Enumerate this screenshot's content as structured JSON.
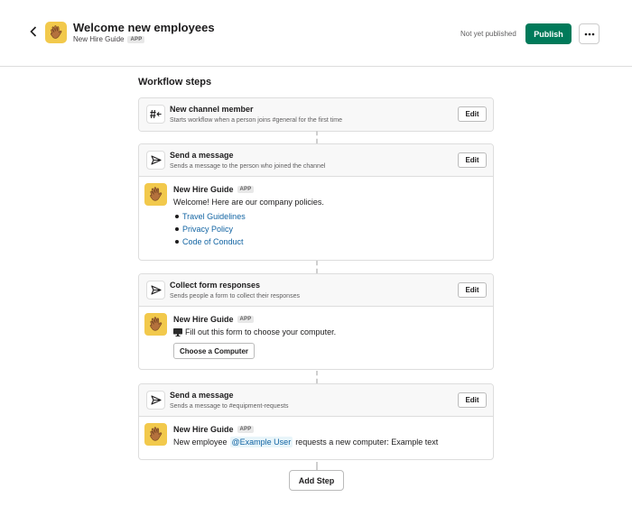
{
  "header": {
    "title": "Welcome new employees",
    "app_name": "New Hire Guide",
    "app_badge": "APP",
    "status": "Not yet published",
    "publish_label": "Publish",
    "more_icon": "more-horizontal-icon",
    "back_icon": "chevron-left-icon"
  },
  "section_title": "Workflow steps",
  "steps": [
    {
      "name": "New channel member",
      "description": "Starts workflow when a person joins #general for the first time",
      "icon": "channel-join-icon",
      "edit_label": "Edit"
    },
    {
      "name": "Send a message",
      "description": "Sends a message to the person who joined the channel",
      "icon": "send-icon",
      "edit_label": "Edit",
      "message": {
        "author": "New Hire Guide",
        "badge": "APP",
        "text": "Welcome! Here are our company policies.",
        "links": [
          "Travel Guidelines",
          "Privacy Policy",
          "Code of Conduct"
        ]
      }
    },
    {
      "name": "Collect form responses",
      "description": "Sends people a form to collect their responses",
      "icon": "send-icon",
      "edit_label": "Edit",
      "message": {
        "author": "New Hire Guide",
        "badge": "APP",
        "text": "Fill out this form to choose your computer.",
        "text_icon": "computer-icon",
        "button_label": "Choose a Computer"
      }
    },
    {
      "name": "Send a message",
      "description": "Sends a message to #equipment-requests",
      "icon": "send-icon",
      "edit_label": "Edit",
      "message": {
        "author": "New Hire Guide",
        "badge": "APP",
        "text_before": "New employee",
        "mention": "@Example User",
        "text_after": "requests a new computer: Example text"
      }
    }
  ],
  "add_step_label": "Add Step",
  "colors": {
    "publish": "#007a5a",
    "link": "#1264a3",
    "app_icon_bg": "#f2c94c"
  }
}
